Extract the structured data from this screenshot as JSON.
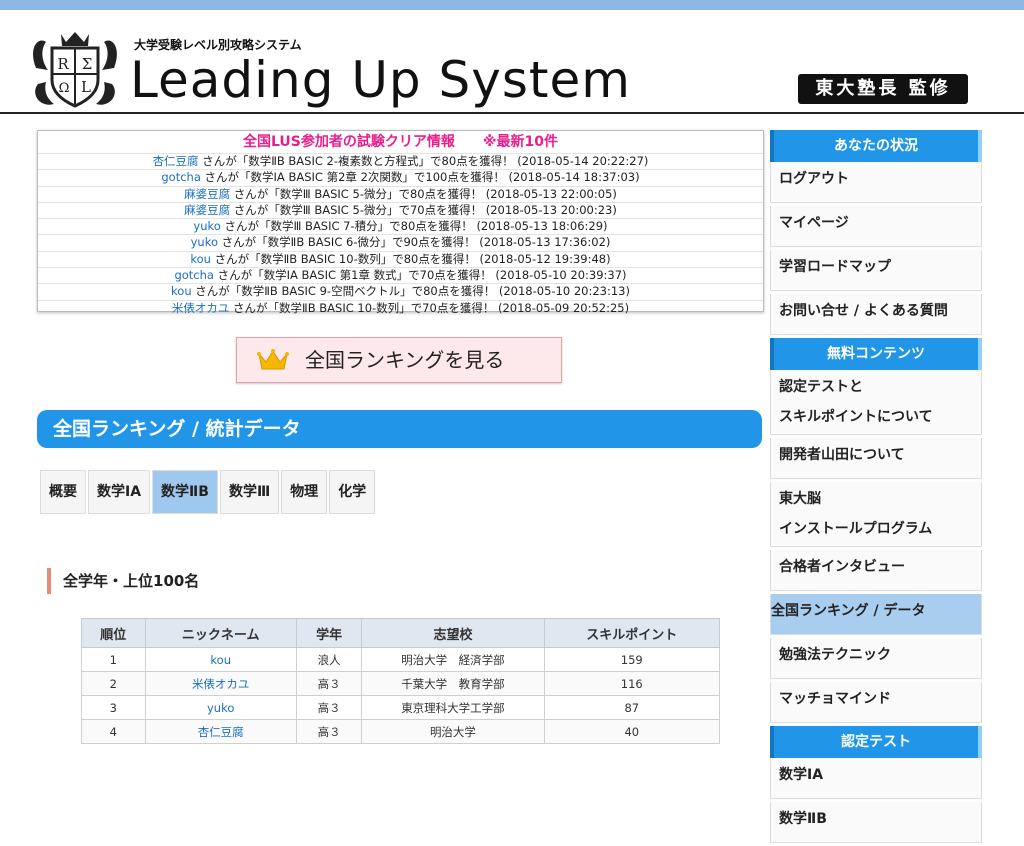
{
  "header": {
    "emblem_letters": [
      "R",
      "Σ",
      "Ω",
      "L"
    ],
    "tagline": "大学受験レベル別攻略システム",
    "wordmark": "Leading Up System",
    "supervise": "東大塾長 監修"
  },
  "news": {
    "title": "全国LUS参加者の試験クリア情報",
    "latest": "※最新10件",
    "items": [
      {
        "nick": "杏仁豆腐",
        "text": " さんが「数学ⅡB BASIC 2-複素数と方程式」で80点を獲得！ (2018-05-14 20:22:27)"
      },
      {
        "nick": "gotcha",
        "text": " さんが「数学ⅠA BASIC 第2章 2次関数」で100点を獲得！ (2018-05-14 18:37:03)"
      },
      {
        "nick": "麻婆豆腐",
        "text": " さんが「数学Ⅲ BASIC 5-微分」で80点を獲得！ (2018-05-13 22:00:05)"
      },
      {
        "nick": "麻婆豆腐",
        "text": " さんが「数学Ⅲ BASIC 5-微分」で70点を獲得！ (2018-05-13 20:00:23)"
      },
      {
        "nick": "yuko",
        "text": " さんが「数学Ⅲ BASIC 7-積分」で80点を獲得！ (2018-05-13 18:06:29)"
      },
      {
        "nick": "yuko",
        "text": " さんが「数学ⅡB BASIC 6-微分」で90点を獲得！ (2018-05-13 17:36:02)"
      },
      {
        "nick": "kou",
        "text": " さんが「数学ⅡB BASIC 10-数列」で80点を獲得！ (2018-05-12 19:39:48)"
      },
      {
        "nick": "gotcha",
        "text": " さんが「数学ⅠA BASIC 第1章 数式」で70点を獲得！ (2018-05-10 20:39:37)"
      },
      {
        "nick": "kou",
        "text": " さんが「数学ⅡB BASIC 9-空間ベクトル」で80点を獲得！ (2018-05-10 20:23:13)"
      },
      {
        "nick": "米俵オカユ",
        "text": " さんが「数学ⅡB BASIC 10-数列」で70点を獲得！ (2018-05-09 20:52:25)"
      }
    ]
  },
  "ranking_button": "全国ランキングを見る",
  "section_title": "全国ランキング / 統計データ",
  "tabs": [
    "概要",
    "数学ⅠA",
    "数学ⅡB",
    "数学Ⅲ",
    "物理",
    "化学"
  ],
  "active_tab_index": 2,
  "subheading": "全学年・上位100名",
  "table": {
    "headers": [
      "順位",
      "ニックネーム",
      "学年",
      "志望校",
      "スキルポイント"
    ],
    "rows": [
      [
        "1",
        "kou",
        "浪人",
        "明治大学　経済学部",
        "159"
      ],
      [
        "2",
        "米俵オカユ",
        "高３",
        "千葉大学　教育学部",
        "116"
      ],
      [
        "3",
        "yuko",
        "高３",
        "東京理科大学工学部",
        "87"
      ],
      [
        "4",
        "杏仁豆腐",
        "高３",
        "明治大学",
        "40"
      ]
    ]
  },
  "sidebar": {
    "status_title": "あなたの状況",
    "status_items": [
      "ログアウト",
      "マイページ",
      "学習ロードマップ",
      "お問い合せ / よくある質問"
    ],
    "free_title": "無料コンテンツ",
    "free_items": [
      [
        "認定テストと",
        "スキルポイントについて"
      ],
      [
        "開発者山田について"
      ],
      [
        "東大脳",
        "インストールプログラム"
      ],
      [
        "合格者インタビュー"
      ],
      [
        "全国ランキング / データ"
      ],
      [
        "勉強法テクニック"
      ],
      [
        "マッチョマインド"
      ]
    ],
    "free_active_index": 4,
    "test_title": "認定テスト",
    "test_items": [
      "数学ⅠA",
      "数学ⅡB"
    ]
  },
  "colors": {
    "accent": "#2196e8",
    "news_title": "#e91e8c",
    "nick_link": "#1a6fc4",
    "active_tab": "#9fc8f0"
  }
}
